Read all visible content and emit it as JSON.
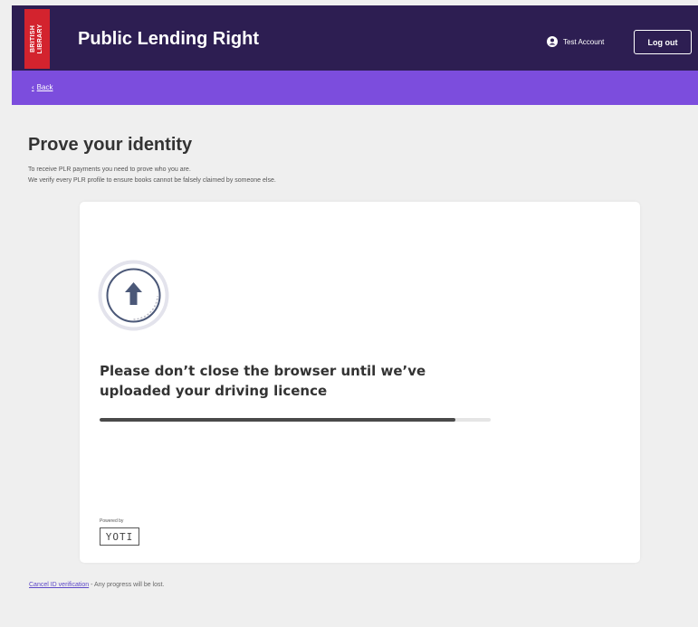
{
  "header": {
    "logo_lines": [
      "BRITISH",
      "LIBRARY"
    ],
    "title": "Public Lending Right",
    "account_name": "Test Account",
    "logout_label": "Log out",
    "colors": {
      "header_bg": "#2d1e52",
      "logo_bg": "#d3232e",
      "subnav_bg": "#7c4ddd"
    }
  },
  "nav": {
    "back_label": "Back"
  },
  "main": {
    "title": "Prove your identity",
    "intro_line_1": "To receive PLR payments you need to prove who you are.",
    "intro_line_2": "We verify every PLR profile to ensure books cannot be falsely claimed by someone else."
  },
  "upload": {
    "icon": "upload-arrow-icon",
    "message": "Please don’t close the browser until we’ve uploaded your driving licence",
    "progress": 0.91,
    "powered_by": "Powered by",
    "brand": "YOTI"
  },
  "footer": {
    "cancel_link": "Cancel ID verification",
    "cancel_note": " - Any progress will be lost."
  }
}
